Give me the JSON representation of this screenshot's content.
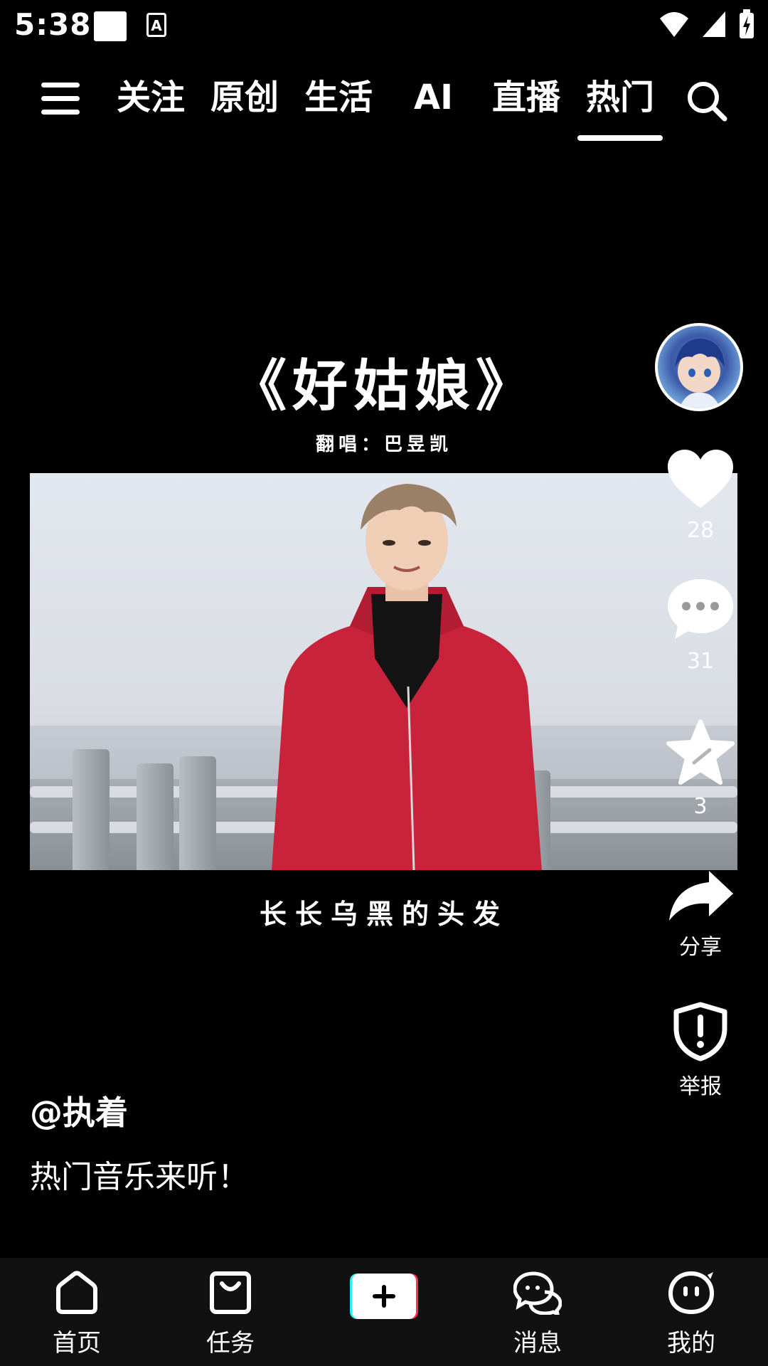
{
  "status_bar": {
    "time": "5:38"
  },
  "top_nav": {
    "tabs": [
      {
        "label": "关注"
      },
      {
        "label": "原创"
      },
      {
        "label": "生活"
      },
      {
        "label": "AI"
      },
      {
        "label": "直播"
      },
      {
        "label": "热门"
      }
    ],
    "active_tab": "热门"
  },
  "video": {
    "title": "《好姑娘》",
    "subtitle": "翻唱：巴昱凯",
    "caption": "长长乌黑的头发"
  },
  "actions": {
    "like_count": "28",
    "comment_count": "31",
    "favorite_count": "3",
    "share_label": "分享",
    "report_label": "举报"
  },
  "post": {
    "author": "@执着",
    "description": "热门音乐来听！"
  },
  "bottom_nav": {
    "items": [
      {
        "label": "首页"
      },
      {
        "label": "任务"
      },
      {
        "label": "消息"
      },
      {
        "label": "我的"
      }
    ]
  },
  "colors": {
    "background": "#000000",
    "bottom_bar": "#111111",
    "icon_white": "#ffffff",
    "jacket_red": "#c8233a",
    "add_button_cyan": "#25f4ee",
    "add_button_red": "#fe2c55"
  }
}
